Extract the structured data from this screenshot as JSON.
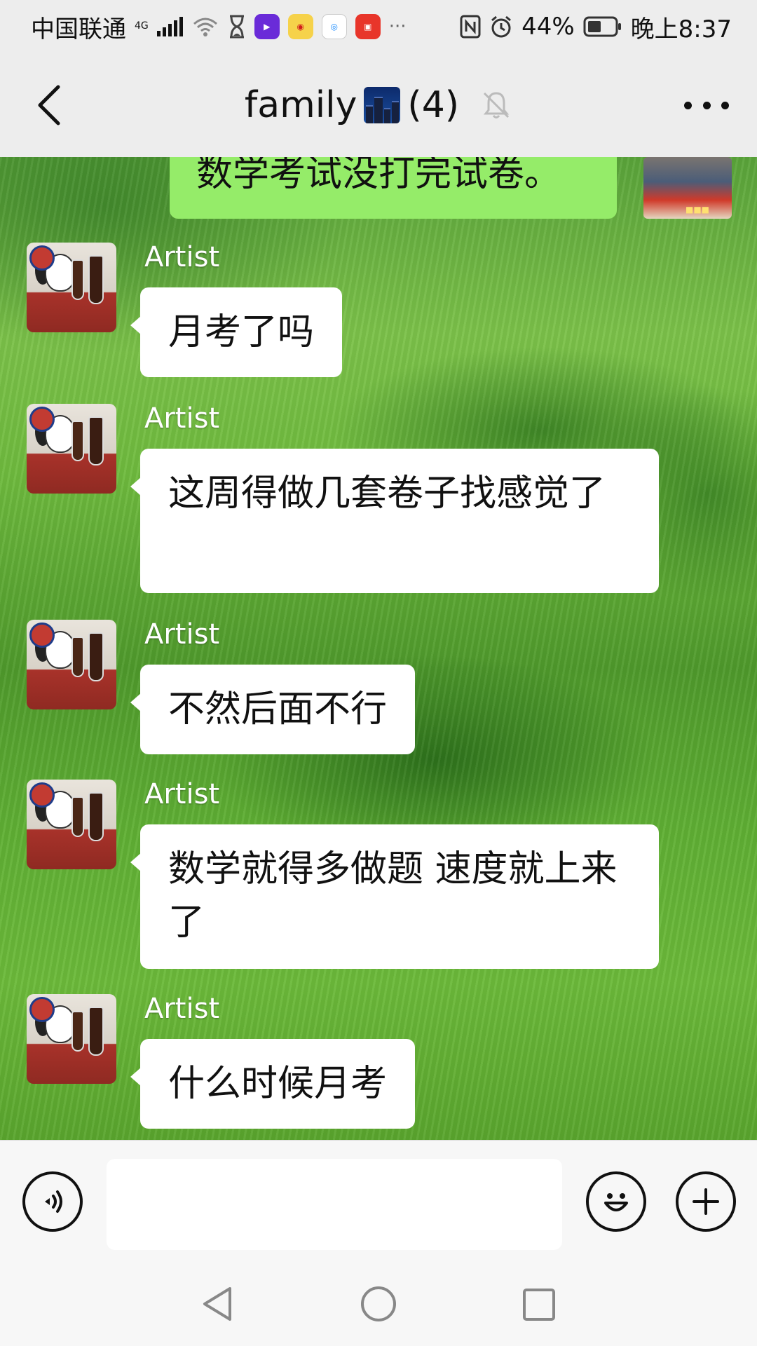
{
  "status": {
    "carrier": "中国联通",
    "network": "4G",
    "battery": "44%",
    "time": "晚上8:37",
    "more_notifications": "···"
  },
  "header": {
    "title": "family",
    "member_count": "(4)"
  },
  "messages": [
    {
      "sender": "me",
      "text": "数学考试没打完试卷。"
    },
    {
      "sender": "Artist",
      "text": "月考了吗"
    },
    {
      "sender": "Artist",
      "text": "这周得做几套卷子找感觉了"
    },
    {
      "sender": "Artist",
      "text": "不然后面不行"
    },
    {
      "sender": "Artist",
      "text": "数学就得多做题 速度就上来了"
    },
    {
      "sender": "Artist",
      "text": "什么时候月考"
    }
  ],
  "input": {
    "value": ""
  },
  "icons": {
    "back": "back-arrow-icon",
    "muted": "bell-off-icon",
    "more": "more-dots-icon",
    "voice": "voice-icon",
    "emoji": "emoji-icon",
    "plus": "plus-icon"
  },
  "colors": {
    "my_bubble": "#95ec69",
    "other_bubble": "#ffffff",
    "bar_bg": "#ededed"
  }
}
